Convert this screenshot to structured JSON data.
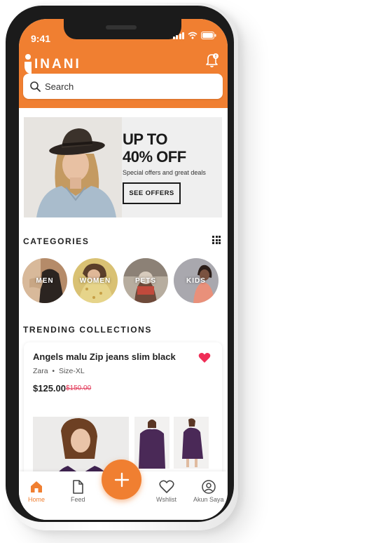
{
  "status": {
    "time": "9:41"
  },
  "brand": {
    "name": "INANI",
    "accent": "#f07f31"
  },
  "notifications": {
    "has_alert": true,
    "icon": "bell-icon"
  },
  "search": {
    "placeholder": "Search"
  },
  "promo": {
    "title": "UP TO\n40% OFF",
    "subtitle": "Special offers and great deals",
    "button_label": "SEE OFFERS"
  },
  "categories": {
    "title": "CATEGORIES",
    "items": [
      {
        "label": "MEN"
      },
      {
        "label": "WOMEN"
      },
      {
        "label": "PETS"
      },
      {
        "label": "KIDS"
      }
    ]
  },
  "trending": {
    "title": "TRENDING COLLECTIONS",
    "product": {
      "name": "Angels malu Zip jeans slim black",
      "brand": "Zara",
      "size": "Size-XL",
      "price": "$125.00",
      "old_price": "$150.00",
      "favorited": true
    }
  },
  "nav": {
    "home": "Home",
    "feed": "Feed",
    "add": "+",
    "wishlist": "Wshlist",
    "account": "Akun Saya"
  }
}
